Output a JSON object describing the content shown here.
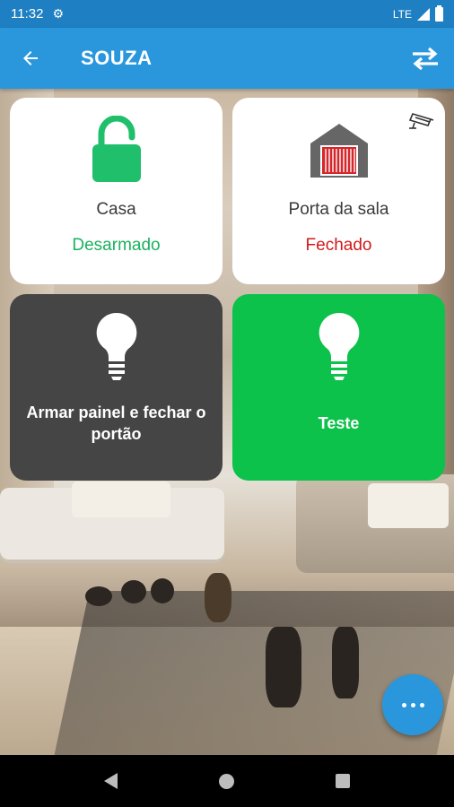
{
  "status_bar": {
    "time": "11:32",
    "network": "LTE",
    "settings_icon": "gear-icon"
  },
  "app_bar": {
    "title": "SOUZA",
    "back_icon": "arrow-left-icon",
    "swap_icon": "swap-arrows-icon",
    "color": "#2a97dd"
  },
  "cards": [
    {
      "name": "Casa",
      "state": "Desarmado",
      "state_color": "#19b25e",
      "icon": "unlocked-padlock-icon"
    },
    {
      "name": "Porta da sala",
      "state": "Fechado",
      "state_color": "#d21a1a",
      "icon": "garage-icon",
      "extra_icon": "security-camera-icon"
    },
    {
      "label": "Armar painel e fechar o portão",
      "icon": "light-bulb-icon",
      "background": "#454545"
    },
    {
      "label": "Teste",
      "icon": "light-bulb-icon",
      "background": "#0cc24a"
    }
  ],
  "fab": {
    "icon": "more-horizontal-icon"
  },
  "nav": {
    "back_icon": "nav-back-icon",
    "home_icon": "nav-home-icon",
    "recent_icon": "nav-recent-icon"
  }
}
